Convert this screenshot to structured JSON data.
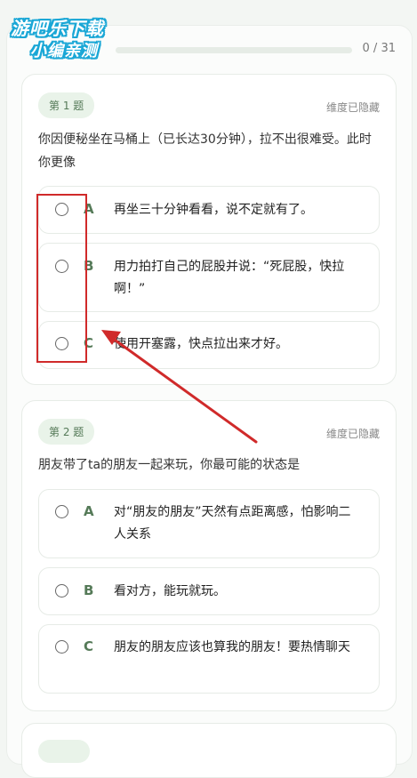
{
  "watermark": {
    "line1": "游吧乐下载",
    "line2": "小编亲测"
  },
  "progress": {
    "text": "0 / 31",
    "value": 0
  },
  "questions": [
    {
      "badge": "第 1 题",
      "hidden": "维度已隐藏",
      "text": "你因便秘坐在马桶上（已长达30分钟），拉不出很难受。此时你更像",
      "options": [
        {
          "letter": "A",
          "text": "再坐三十分钟看看，说不定就有了。"
        },
        {
          "letter": "B",
          "text": "用力拍打自己的屁股并说：“死屁股，快拉啊！”"
        },
        {
          "letter": "C",
          "text": "使用开塞露，快点拉出来才好。"
        }
      ]
    },
    {
      "badge": "第 2 题",
      "hidden": "维度已隐藏",
      "text": "朋友带了ta的朋友一起来玩，你最可能的状态是",
      "options": [
        {
          "letter": "A",
          "text": "对“朋友的朋友”天然有点距离感，怕影响二人关系"
        },
        {
          "letter": "B",
          "text": "看对方，能玩就玩。"
        },
        {
          "letter": "C",
          "text": "朋友的朋友应该也算我的朋友！要热情聊天"
        }
      ]
    }
  ],
  "colors": {
    "accent": "#557a58",
    "annotation": "#d02a2a"
  }
}
